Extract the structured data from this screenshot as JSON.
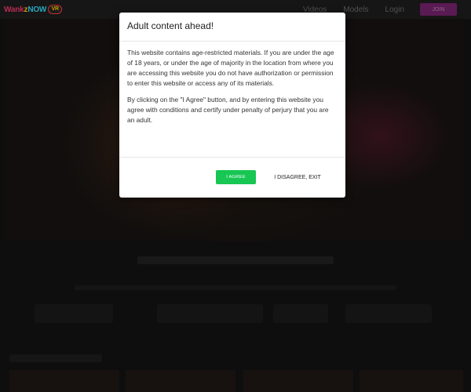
{
  "navbar": {
    "logo": {
      "part1": "Wank",
      "part2": "z",
      "part3": "NOW",
      "badge": "VR"
    },
    "links": [
      "Videos",
      "Models",
      "Login"
    ],
    "join_label": "JOIN"
  },
  "modal": {
    "title": "Adult content ahead!",
    "paragraph1": "This website contains age-restricted materials. If you are under the age of 18 years, or under the age of majority in the location from where you are accessing this website you do not have authorization or permission to enter this website or access any of its materials.",
    "paragraph2": "By clicking on the \"I Agree\" button, and by entering this website you agree with conditions and certify under penalty of perjury that you are an adult.",
    "agree_label": "I AGREE",
    "disagree_label": "I DISAGREE, EXIT"
  },
  "colors": {
    "agree_button": "#17c653",
    "join_button": "#6a1f62",
    "navbar_bg": "#1a1a1a"
  }
}
